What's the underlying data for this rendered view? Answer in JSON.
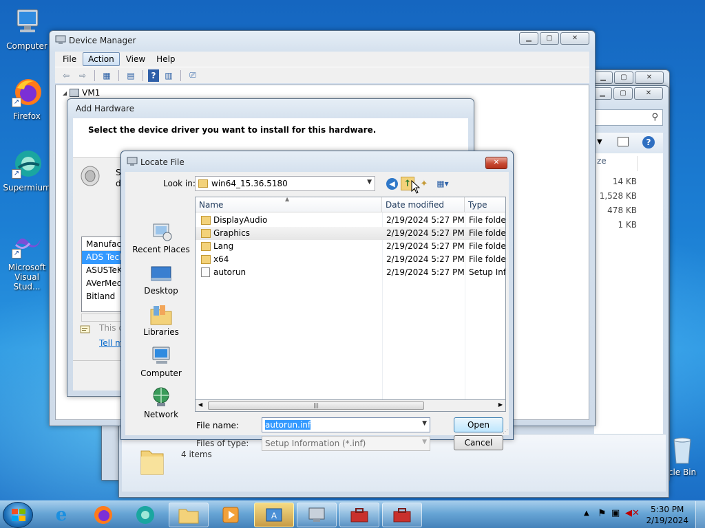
{
  "desktop": {
    "icons": [
      {
        "label": "Computer"
      },
      {
        "label": "Firefox"
      },
      {
        "label": "Supermium"
      },
      {
        "label": "Microsoft Visual Stud..."
      },
      {
        "label": "cle Bin"
      }
    ]
  },
  "bg_windows": {
    "search_icon": "search-icon",
    "size_col_label": "ze",
    "sizes": [
      "14 KB",
      "1,528 KB",
      "478 KB",
      "1 KB"
    ],
    "status": "4 items"
  },
  "device_manager": {
    "title": "Device Manager",
    "menu": [
      "File",
      "Action",
      "View",
      "Help"
    ],
    "tree_root": "VM1"
  },
  "add_hardware": {
    "title": "Add Hardware",
    "heading": "Select the device driver you want to install for this hardware.",
    "partial_text_s": "S",
    "partial_text_d": "d",
    "list_header": "Manufact",
    "list_items": [
      "ADS Tech",
      "ASUSTeK",
      "AVerMed",
      "Bitland"
    ],
    "info_text": "This d",
    "link_text": "Tell m"
  },
  "locate_file": {
    "title": "Locate File",
    "look_in_label": "Look in:",
    "look_in_value": "win64_15.36.5180",
    "places": [
      "Recent Places",
      "Desktop",
      "Libraries",
      "Computer",
      "Network"
    ],
    "columns": [
      "Name",
      "Date modified",
      "Type"
    ],
    "files": [
      {
        "name": "DisplayAudio",
        "date": "2/19/2024 5:27 PM",
        "type": "File folder",
        "kind": "folder"
      },
      {
        "name": "Graphics",
        "date": "2/19/2024 5:27 PM",
        "type": "File folder",
        "kind": "folder"
      },
      {
        "name": "Lang",
        "date": "2/19/2024 5:27 PM",
        "type": "File folder",
        "kind": "folder"
      },
      {
        "name": "x64",
        "date": "2/19/2024 5:27 PM",
        "type": "File folder",
        "kind": "folder"
      },
      {
        "name": "autorun",
        "date": "2/19/2024 5:27 PM",
        "type": "Setup Infc",
        "kind": "inf"
      }
    ],
    "file_name_label": "File name:",
    "file_name_value": "autorun.inf",
    "files_of_type_label": "Files of type:",
    "files_of_type_value": "Setup Information (*.inf)",
    "open_label": "Open",
    "cancel_label": "Cancel"
  },
  "taskbar": {
    "time": "5:30 PM",
    "date": "2/19/2024"
  },
  "colors": {
    "selection": "#3399ff",
    "close_red": "#c74a33"
  }
}
